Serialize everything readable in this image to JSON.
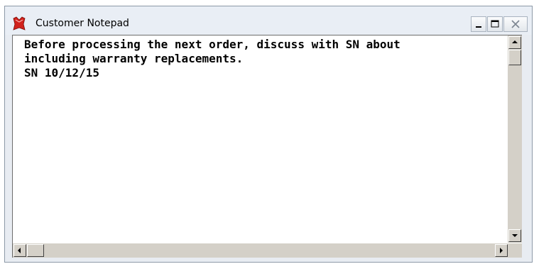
{
  "window": {
    "title": "Customer Notepad",
    "controls": [
      "minimize-icon",
      "maximize-icon",
      "close-icon"
    ]
  },
  "notepad": {
    "lines": [
      "Before processing the next order, discuss with SN about",
      "including warranty replacements.",
      "SN 10/12/15"
    ]
  },
  "colors": {
    "titlebar": "#e9eef5",
    "scrollbar": "#d4d0c8",
    "text": "#000000"
  }
}
